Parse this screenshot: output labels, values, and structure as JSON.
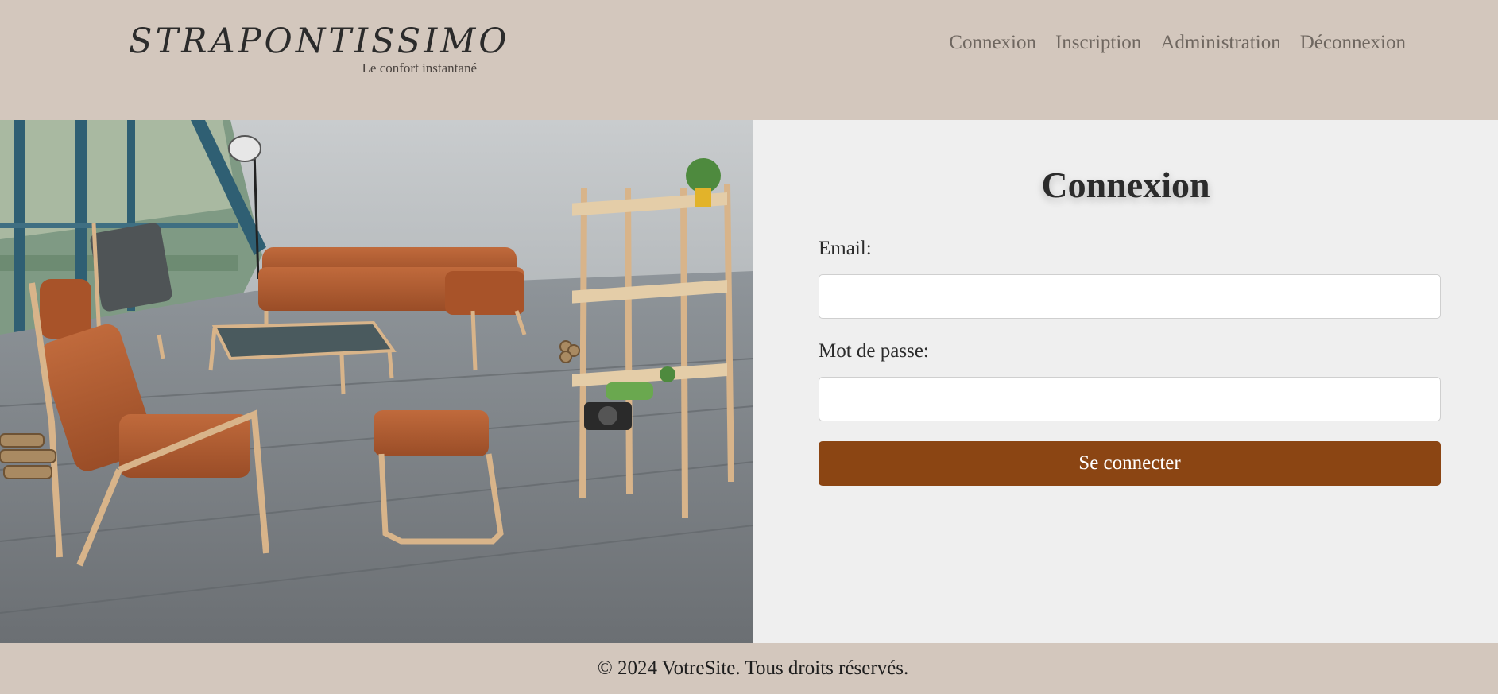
{
  "brand": {
    "title": "STRAPONTISSIMO",
    "tagline": "Le confort instantané"
  },
  "nav": {
    "login": "Connexion",
    "signup": "Inscription",
    "admin": "Administration",
    "logout": "Déconnexion"
  },
  "login": {
    "heading": "Connexion",
    "email_label": "Email:",
    "email_value": "",
    "password_label": "Mot de passe:",
    "password_value": "",
    "submit_label": "Se connecter"
  },
  "footer": {
    "text": "© 2024 VotreSite. Tous droits réservés."
  },
  "colors": {
    "header_bg": "#d3c7bd",
    "panel_bg": "#efefef",
    "button_bg": "#8b4513",
    "nav_text": "#6f6760"
  }
}
